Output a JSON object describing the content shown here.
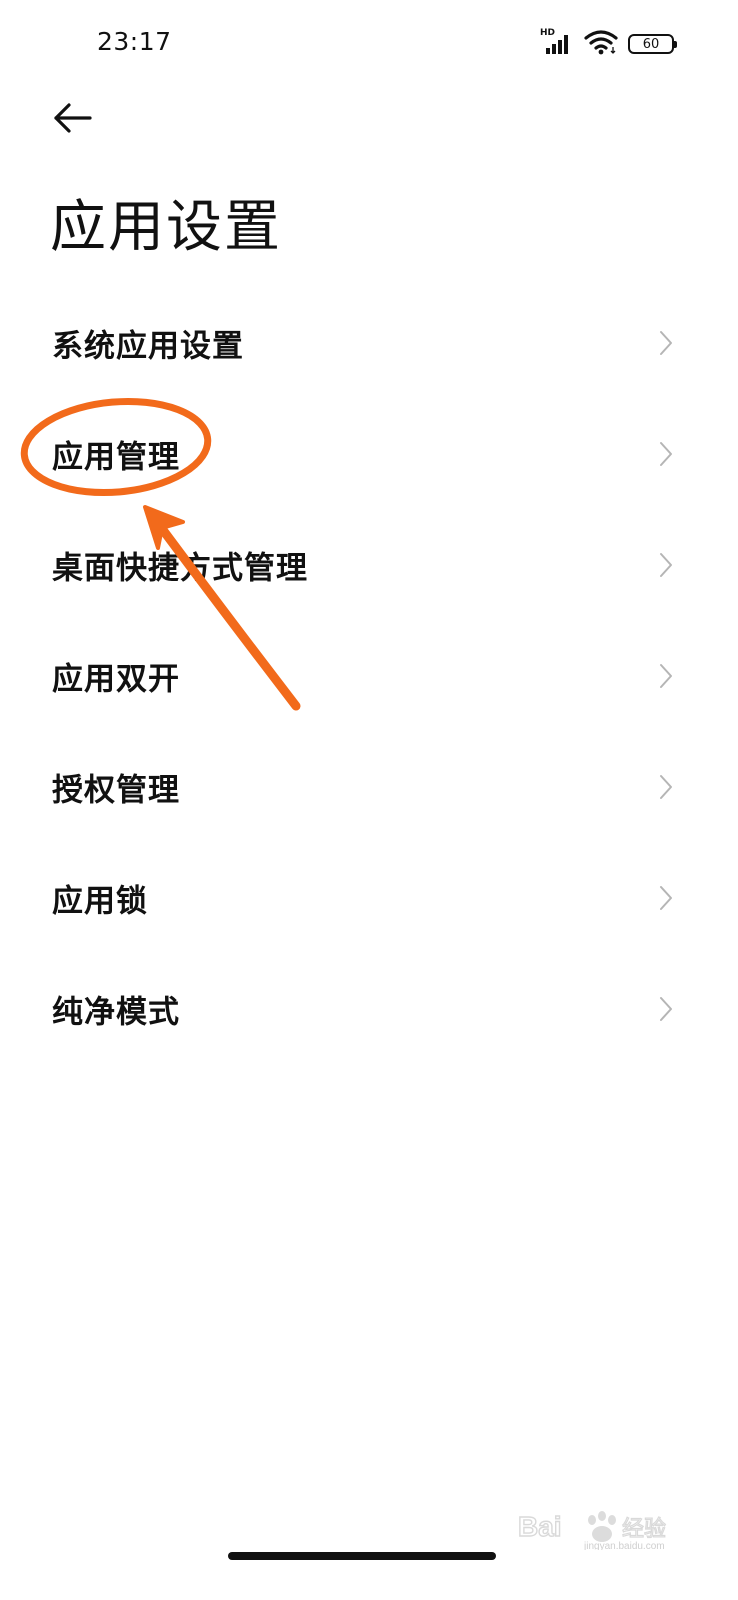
{
  "status_bar": {
    "time": "23:17",
    "network_label": "HD",
    "battery_level": "60"
  },
  "header": {
    "title": "应用设置"
  },
  "menu": {
    "items": [
      {
        "label": "系统应用设置"
      },
      {
        "label": "应用管理"
      },
      {
        "label": "桌面快捷方式管理"
      },
      {
        "label": "应用双开"
      },
      {
        "label": "授权管理"
      },
      {
        "label": "应用锁"
      },
      {
        "label": "纯净模式"
      }
    ]
  },
  "annotation": {
    "color": "#f26a1b",
    "highlighted_item": "应用管理"
  },
  "watermark": {
    "brand": "Bai",
    "brand_suffix": "经验",
    "url": "jingyan.baidu.com"
  },
  "colors": {
    "text": "#111111",
    "chevron": "#b5b5b5",
    "annotation": "#f26a1b"
  }
}
